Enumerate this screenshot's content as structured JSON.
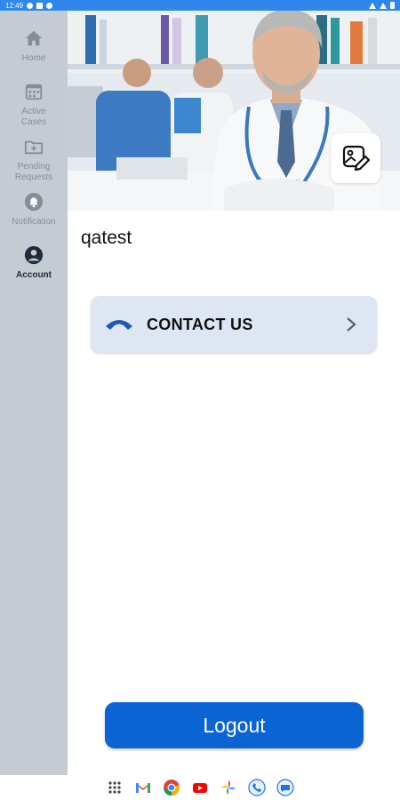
{
  "status_bar": {
    "time": "12:49"
  },
  "sidebar": {
    "items": [
      {
        "label": "Home",
        "icon": "home-icon"
      },
      {
        "label": "Active\nCases",
        "icon": "calendar-icon"
      },
      {
        "label": "Pending\nRequests",
        "icon": "folder-icon"
      },
      {
        "label": "Notification",
        "icon": "bell-icon"
      },
      {
        "label": "Account",
        "icon": "account-icon",
        "active": true
      }
    ]
  },
  "profile": {
    "username": "qatest",
    "hero_image": "doctor-photo",
    "edit_photo_icon": "edit-image-icon"
  },
  "contact": {
    "label": "CONTACT US",
    "icon": "phone-icon",
    "chevron_icon": "chevron-right-icon"
  },
  "logout": {
    "label": "Logout"
  },
  "dock": {
    "apps": [
      "app-drawer-icon",
      "gmail-icon",
      "chrome-icon",
      "youtube-icon",
      "photos-icon",
      "phone-icon",
      "messages-icon"
    ]
  },
  "colors": {
    "sidebar_bg": "#c5cbd3",
    "active_nav": "#1f2a3a",
    "inactive_nav": "#868d96",
    "contact_card_bg": "#dfe6f3",
    "logout_bg": "#0a64d4",
    "status_bar_bg": "#2f86ec"
  }
}
